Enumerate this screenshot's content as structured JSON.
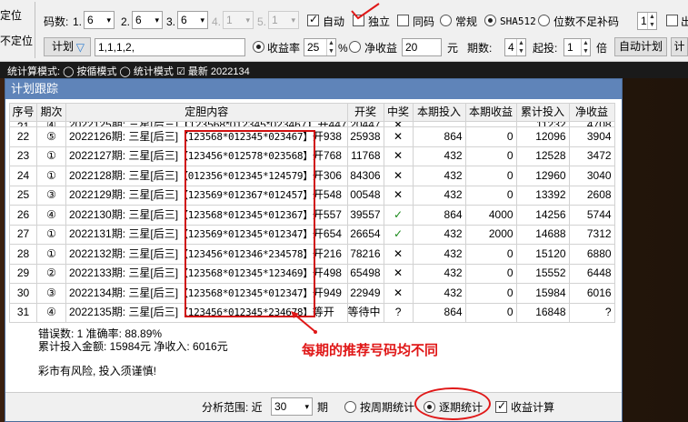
{
  "toolbar": {
    "left_labels": [
      "定位",
      "不定位"
    ],
    "code_digits_label": "码数:",
    "positions": [
      {
        "index": "1.",
        "value": "6",
        "enabled": true
      },
      {
        "index": "2.",
        "value": "6",
        "enabled": true
      },
      {
        "index": "3.",
        "value": "6",
        "enabled": true
      },
      {
        "index": "4.",
        "value": "1",
        "enabled": false
      },
      {
        "index": "5.",
        "value": "1",
        "enabled": false
      }
    ],
    "auto_label": "自动",
    "independent_label": "独立",
    "same_code_label": "同码",
    "normal_label": "常规",
    "sha_label": "SHA512",
    "pad_label": "位数不足补码",
    "pad_value": "1",
    "extra_label": "出",
    "plan_button": "计划",
    "plan_value": "1,1,1,2,",
    "yield_label": "收益率",
    "yield_value": "25",
    "percent_sign": "%",
    "net_label": "净收益",
    "net_value": "20",
    "yuan": "元",
    "periods_label": "期数:",
    "periods_value": "4",
    "start_label": "起投:",
    "start_value": "1",
    "times_label": "倍",
    "auto_plan_button": "自动计划",
    "calc_button": "计",
    "strip_text": "统计算模式:  ◯ 按循模式  ◯ 统计模式      ☑ 最新  2022134"
  },
  "window": {
    "title": "计划跟踪",
    "columns": [
      "序号",
      "期次",
      "定胆内容",
      "开奖",
      "中奖",
      "本期投入",
      "本期收益",
      "累计投入",
      "净收益"
    ],
    "partial_row": {
      "seq": "21",
      "issue": "④",
      "content": "2022125期: 三星[后三]【123568*012345*023467】开447",
      "draw": "20447",
      "win": "✕",
      "invest": "",
      "income": "",
      "total": "11232",
      "net": "4708"
    },
    "rows": [
      {
        "seq": "22",
        "issue": "⑤",
        "prefix": "2022126期: 三星[后三]",
        "codes": "【123568*012345*023467】",
        "open": "开938",
        "draw": "25938",
        "win": "✕",
        "invest": "864",
        "income": "0",
        "total": "12096",
        "net": "3904"
      },
      {
        "seq": "23",
        "issue": "①",
        "prefix": "2022127期: 三星[后三]",
        "codes": "【123456*012578*023568】",
        "open": "开768",
        "draw": "11768",
        "win": "✕",
        "invest": "432",
        "income": "0",
        "total": "12528",
        "net": "3472"
      },
      {
        "seq": "24",
        "issue": "①",
        "prefix": "2022128期: 三星[后三]",
        "codes": "【012356*012345*124579】",
        "open": "开306",
        "draw": "84306",
        "win": "✕",
        "invest": "432",
        "income": "0",
        "total": "12960",
        "net": "3040"
      },
      {
        "seq": "25",
        "issue": "③",
        "prefix": "2022129期: 三星[后三]",
        "codes": "【123569*012367*012457】",
        "open": "开548",
        "draw": "00548",
        "win": "✕",
        "invest": "432",
        "income": "0",
        "total": "13392",
        "net": "2608"
      },
      {
        "seq": "26",
        "issue": "④",
        "prefix": "2022130期: 三星[后三]",
        "codes": "【123568*012345*012367】",
        "open": "开557",
        "draw": "39557",
        "win": "✓",
        "invest": "864",
        "income": "4000",
        "total": "14256",
        "net": "5744"
      },
      {
        "seq": "27",
        "issue": "①",
        "prefix": "2022131期: 三星[后三]",
        "codes": "【123569*012345*012347】",
        "open": "开654",
        "draw": "26654",
        "win": "✓",
        "invest": "432",
        "income": "2000",
        "total": "14688",
        "net": "7312"
      },
      {
        "seq": "28",
        "issue": "①",
        "prefix": "2022132期: 三星[后三]",
        "codes": "【123456*012346*234578】",
        "open": "开216",
        "draw": "78216",
        "win": "✕",
        "invest": "432",
        "income": "0",
        "total": "15120",
        "net": "6880"
      },
      {
        "seq": "29",
        "issue": "②",
        "prefix": "2022133期: 三星[后三]",
        "codes": "【123568*012345*123469】",
        "open": "开498",
        "draw": "65498",
        "win": "✕",
        "invest": "432",
        "income": "0",
        "total": "15552",
        "net": "6448"
      },
      {
        "seq": "30",
        "issue": "③",
        "prefix": "2022134期: 三星[后三]",
        "codes": "【123568*012345*012347】",
        "open": "开949",
        "draw": "22949",
        "win": "✕",
        "invest": "432",
        "income": "0",
        "total": "15984",
        "net": "6016"
      },
      {
        "seq": "31",
        "issue": "④",
        "prefix": "2022135期: 三星[后三]",
        "codes": "【123456*012345*234678】",
        "open": "等开",
        "draw": "等待中",
        "win": "?",
        "invest": "864",
        "income": "0",
        "total": "16848",
        "net": "?"
      }
    ],
    "stats": {
      "line1": "错误数: 1   准确率: 88.89%",
      "line2": "累计投入金额: 15984元   净收入: 6016元",
      "warning": "彩市有风险, 投入须谨慎!"
    },
    "annotation": "每期的推荐号码均不同",
    "footer": {
      "range_label": "分析范围: 近",
      "range_value": "30",
      "period_label": "期",
      "weekly_label": "按周期统计",
      "per_issue_label": "逐期统计",
      "income_label": "收益计算"
    }
  },
  "colors": {
    "title_bar": "#5f84b9",
    "annotation_red": "#e01818",
    "win_green": "#1a8a1a"
  }
}
